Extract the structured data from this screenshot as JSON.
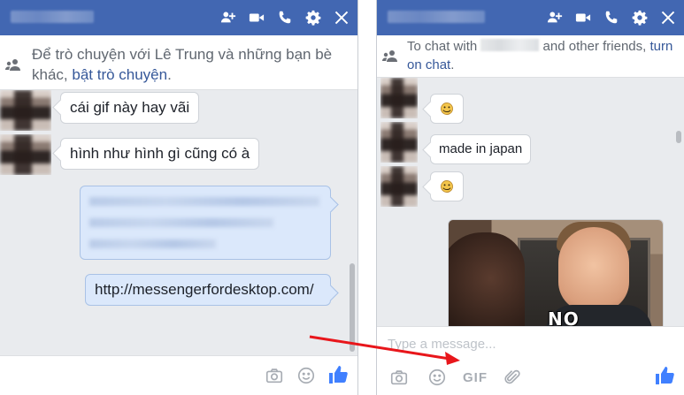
{
  "left_chat": {
    "notice_prefix": "Để trò chuyện với Lê Trung và những bạn bè khác, ",
    "notice_link": "bật trò chuyện",
    "notice_suffix": ".",
    "messages": [
      "cái gif này hay vãi",
      "hình như hình gì cũng có à",
      "http://messengerfordesktop.com/"
    ]
  },
  "right_chat": {
    "notice_prefix": "To chat with",
    "notice_middle": " and other friends, ",
    "notice_link": "turn on chat",
    "notice_suffix": ".",
    "messages": [
      "made in japan"
    ],
    "gif_caption": "NO",
    "composer_placeholder": "Type a message...",
    "gif_button_label": "GIF"
  },
  "colors": {
    "header": "#4267b2",
    "link": "#365899",
    "outgoing_bubble": "#dbe8fb",
    "like": "#4080ff",
    "annotation_arrow": "#e8161b"
  },
  "icons": [
    "add-friend-icon",
    "video-call-icon",
    "phone-icon",
    "gear-icon",
    "close-icon",
    "friends-icon",
    "camera-icon",
    "emoji-icon",
    "gif-icon",
    "attachment-icon",
    "thumbs-up-icon"
  ]
}
